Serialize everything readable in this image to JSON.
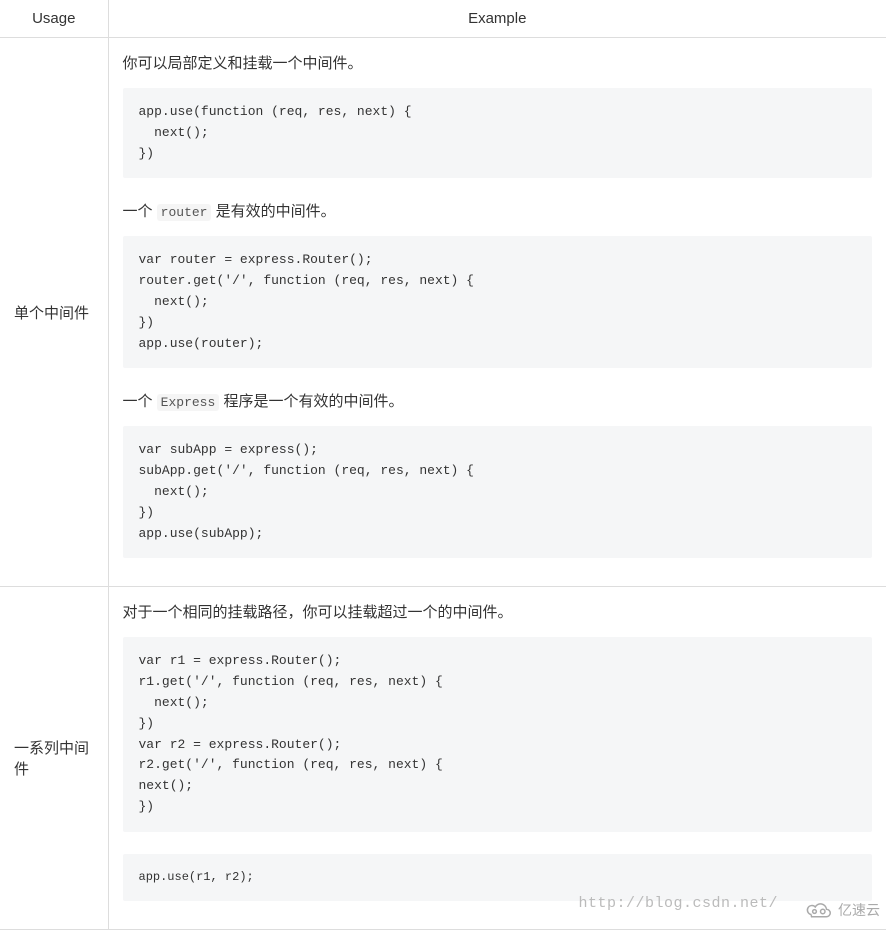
{
  "headers": {
    "usage": "Usage",
    "example": "Example"
  },
  "rows": [
    {
      "usage": "单个中间件",
      "sections": [
        {
          "desc_parts": [
            "你可以局部定义和挂载一个中间件。"
          ],
          "code": "app.use(function (req, res, next) {\n  next();\n})"
        },
        {
          "desc_parts": [
            "一个 ",
            {
              "code": "router"
            },
            " 是有效的中间件。"
          ],
          "code": "var router = express.Router();\nrouter.get('/', function (req, res, next) {\n  next();\n})\napp.use(router);"
        },
        {
          "desc_parts": [
            "一个 ",
            {
              "code": "Express"
            },
            " 程序是一个有效的中间件。"
          ],
          "code": "var subApp = express();\nsubApp.get('/', function (req, res, next) {\n  next();\n})\napp.use(subApp);"
        }
      ]
    },
    {
      "usage": "一系列中间件",
      "sections": [
        {
          "desc_parts": [
            "对于一个相同的挂载路径，你可以挂载超过一个的中间件。"
          ],
          "code": "var r1 = express.Router();\nr1.get('/', function (req, res, next) {\n  next();\n})\nvar r2 = express.Router();\nr2.get('/', function (req, res, next) {\nnext();\n})",
          "code2": "app.use(r1, r2);"
        }
      ]
    }
  ],
  "watermark": {
    "url": "http://blog.csdn.net/",
    "logo_text": "亿速云"
  }
}
